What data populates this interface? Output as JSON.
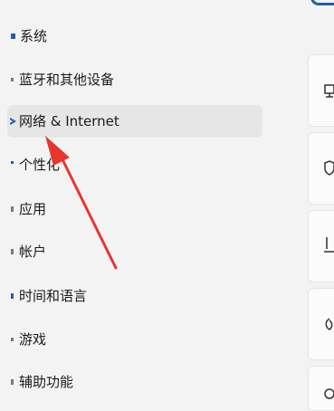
{
  "sidebar": {
    "items": [
      {
        "label": "系统",
        "icon": "monitor-icon"
      },
      {
        "label": "蓝牙和其他设备",
        "icon": "bluetooth-icon"
      },
      {
        "label": "网络 & Internet",
        "icon": "wifi-icon",
        "active": true
      },
      {
        "label": "个性化",
        "icon": "brush-icon"
      },
      {
        "label": "应用",
        "icon": "apps-icon"
      },
      {
        "label": "帐户",
        "icon": "person-icon"
      },
      {
        "label": "时间和语言",
        "icon": "clock-icon"
      },
      {
        "label": "游戏",
        "icon": "gamepad-icon"
      },
      {
        "label": "辅助功能",
        "icon": "accessibility-icon"
      }
    ]
  },
  "content": {
    "cards": [
      {
        "icon": "monitor-icon"
      },
      {
        "icon": "shield-icon"
      },
      {
        "icon": "download-icon"
      },
      {
        "icon": "phone-icon"
      },
      {
        "icon": "info-icon"
      }
    ]
  },
  "annotation": {
    "type": "red-arrow",
    "color": "#e8362c"
  },
  "colors": {
    "accent": "#1f5fad",
    "active_bg": "#e6e6e6"
  }
}
